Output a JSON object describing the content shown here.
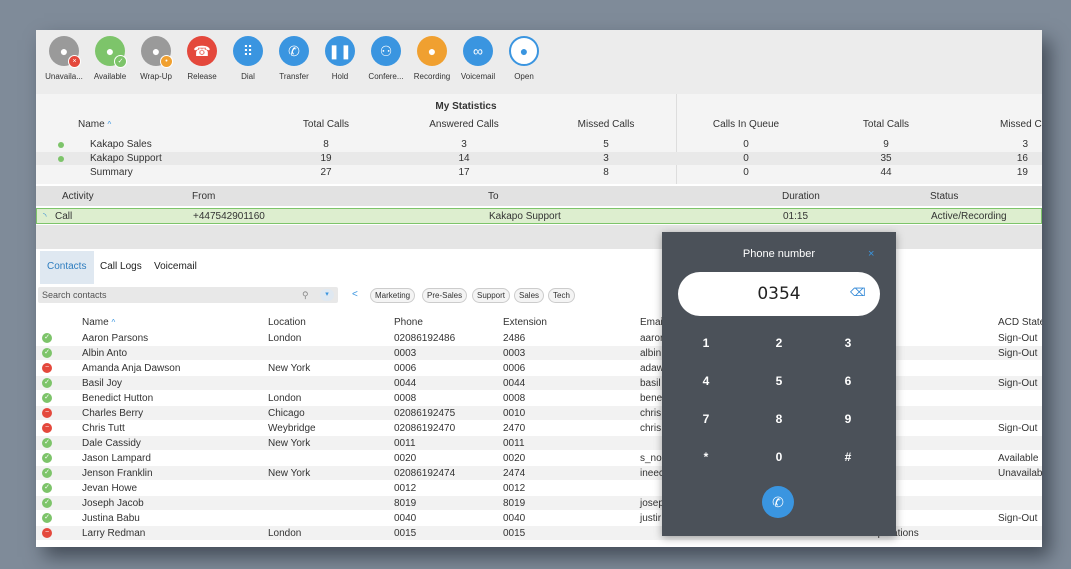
{
  "toolbar": {
    "buttons": [
      {
        "label": "Unavaila...",
        "icon": "user-unavailable-icon",
        "color": "#9a9a9a"
      },
      {
        "label": "Available",
        "icon": "user-available-icon",
        "color": "#7dc46a"
      },
      {
        "label": "Wrap-Up",
        "icon": "user-wrapup-icon",
        "color": "#9a9a9a"
      },
      {
        "label": "Release",
        "icon": "hangup-icon",
        "color": "#e4483c"
      },
      {
        "label": "Dial",
        "icon": "dialpad-icon",
        "color": "#3a95e0"
      },
      {
        "label": "Transfer",
        "icon": "transfer-icon",
        "color": "#3a95e0"
      },
      {
        "label": "Hold",
        "icon": "pause-icon",
        "color": "#3a95e0"
      },
      {
        "label": "Confere...",
        "icon": "conference-icon",
        "color": "#3a95e0"
      },
      {
        "label": "Recording",
        "icon": "microphone-icon",
        "color": "#f0a030"
      },
      {
        "label": "Voicemail",
        "icon": "voicemail-icon",
        "color": "#3a95e0"
      },
      {
        "label": "Open",
        "icon": "chat-icon",
        "color": "#ffffff"
      }
    ]
  },
  "stats": {
    "title": "My Statistics",
    "headers": {
      "name": "Name",
      "total": "Total Calls",
      "answered": "Answered Calls",
      "missed": "Missed Calls",
      "queue": "Calls In Queue",
      "total2": "Total Calls",
      "missed2": "Missed Ca"
    },
    "rows": [
      {
        "name": "Kakapo Sales",
        "total": "8",
        "answered": "3",
        "missed": "5",
        "queue": "0",
        "total2": "9",
        "missed2": "3"
      },
      {
        "name": "Kakapo Support",
        "total": "19",
        "answered": "14",
        "missed": "3",
        "queue": "0",
        "total2": "35",
        "missed2": "16"
      },
      {
        "name": "Summary",
        "total": "27",
        "answered": "17",
        "missed": "8",
        "queue": "0",
        "total2": "44",
        "missed2": "19"
      }
    ]
  },
  "activity": {
    "headers": {
      "activity": "Activity",
      "from": "From",
      "to": "To",
      "duration": "Duration",
      "status": "Status"
    },
    "row": {
      "activity": "Call",
      "from": "+447542901160",
      "to": "Kakapo Support",
      "duration": "01:15",
      "status": "Active/Recording"
    }
  },
  "contacts": {
    "tabs": [
      "Contacts",
      "Call Logs",
      "Voicemail"
    ],
    "search_placeholder": "Search contacts",
    "back_arrow": "<",
    "filters": [
      "Marketing",
      "Pre-Sales",
      "Support",
      "Sales",
      "Tech"
    ],
    "headers": {
      "name": "Name",
      "location": "Location",
      "phone": "Phone",
      "extension": "Extension",
      "email": "Emai",
      "acd": "ACD State"
    },
    "rows": [
      {
        "status": "ok",
        "name": "Aaron Parsons",
        "location": "London",
        "phone": "02086192486",
        "ext": "2486",
        "email": "aaror",
        "dept": "tions",
        "acd": "Sign-Out"
      },
      {
        "status": "ok",
        "name": "Albin Anto",
        "location": "",
        "phone": "0003",
        "ext": "0003",
        "email": "albin",
        "dept": "",
        "acd": "Sign-Out"
      },
      {
        "status": "no",
        "name": "Amanda Anja Dawson",
        "location": "New York",
        "phone": "0006",
        "ext": "0006",
        "email": "adaw",
        "dept": "tions",
        "acd": ""
      },
      {
        "status": "ok",
        "name": "Basil Joy",
        "location": "",
        "phone": "0044",
        "ext": "0044",
        "email": "basil",
        "dept": "",
        "acd": "Sign-Out"
      },
      {
        "status": "ok",
        "name": "Benedict Hutton",
        "location": "London",
        "phone": "0008",
        "ext": "0008",
        "email": "bene",
        "dept": "",
        "acd": ""
      },
      {
        "status": "no",
        "name": "Charles Berry",
        "location": "Chicago",
        "phone": "02086192475",
        "ext": "0010",
        "email": "chris",
        "dept": "ervice",
        "acd": ""
      },
      {
        "status": "no",
        "name": "Chris Tutt",
        "location": "Weybridge",
        "phone": "02086192470",
        "ext": "2470",
        "email": "chris",
        "dept": "",
        "acd": "Sign-Out"
      },
      {
        "status": "ok",
        "name": "Dale Cassidy",
        "location": "New York",
        "phone": "0011",
        "ext": "0011",
        "email": "",
        "dept": "",
        "acd": ""
      },
      {
        "status": "ok",
        "name": "Jason Lampard",
        "location": "",
        "phone": "0020",
        "ext": "0020",
        "email": "s_no",
        "dept": "tions",
        "acd": "Available"
      },
      {
        "status": "ok",
        "name": "Jenson Franklin",
        "location": "New York",
        "phone": "02086192474",
        "ext": "2474",
        "email": "ineec",
        "dept": "",
        "acd": "Unavailab"
      },
      {
        "status": "ok",
        "name": "Jevan Howe",
        "location": "",
        "phone": "0012",
        "ext": "0012",
        "email": "",
        "dept": "ources",
        "acd": ""
      },
      {
        "status": "ok",
        "name": "Joseph Jacob",
        "location": "",
        "phone": "8019",
        "ext": "8019",
        "email": "josep",
        "dept": "",
        "acd": ""
      },
      {
        "status": "ok",
        "name": "Justina Babu",
        "location": "",
        "phone": "0040",
        "ext": "0040",
        "email": "justir",
        "dept": "",
        "acd": "Sign-Out"
      },
      {
        "status": "no",
        "name": "Larry Redman",
        "location": "London",
        "phone": "0015",
        "ext": "0015",
        "email": "",
        "dept": "Sales Operations",
        "acd": ""
      }
    ]
  },
  "dialpad": {
    "title": "Phone number",
    "close": "×",
    "value": "0354",
    "keys": [
      "1",
      "2",
      "3",
      "4",
      "5",
      "6",
      "7",
      "8",
      "9",
      "*",
      "0",
      "#"
    ]
  }
}
